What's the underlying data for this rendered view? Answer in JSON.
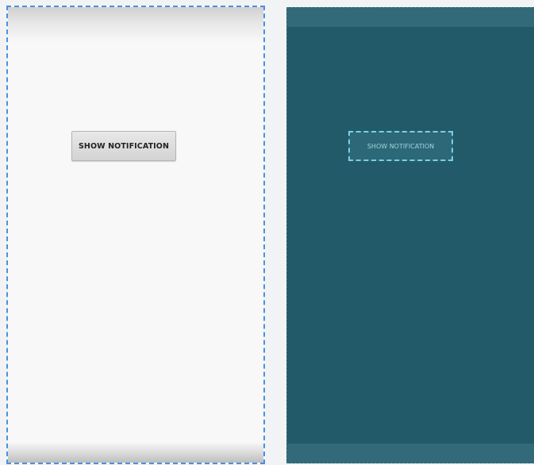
{
  "design_preview": {
    "button_label": "SHOW NOTIFICATION"
  },
  "blueprint_preview": {
    "button_label": "SHOW NOTIFICATION"
  },
  "colors": {
    "selection_outline": "#4a90e2",
    "blueprint_background": "#235a6a",
    "blueprint_outline": "#79d2e0"
  }
}
